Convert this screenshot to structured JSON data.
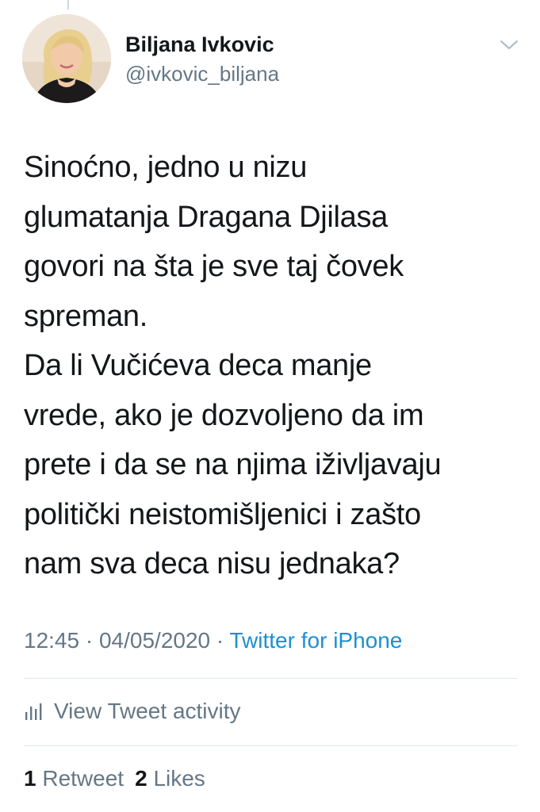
{
  "author": {
    "display_name": "Biljana Ivkovic",
    "handle": "@ivkovic_biljana"
  },
  "tweet": {
    "text": "Sinoćno, jedno u nizu\nglumatanja Dragana Djilasa\ngovori na šta je sve taj čovek\nspreman.\nDa li Vučićeva deca manje\nvrede, ako je dozvoljeno da im\nprete i da se na njima iživljavaju\npolitički neistomišljenici i zašto\nnam sva deca nisu jednaka?"
  },
  "meta": {
    "time": "12:45",
    "separator1": " · ",
    "date": "04/05/2020",
    "separator2": " · ",
    "source": "Twitter for iPhone"
  },
  "activity": {
    "label": "View Tweet activity",
    "icon": "bar-chart-icon"
  },
  "engagement": {
    "retweet_count": "1",
    "retweet_label": "Retweet",
    "like_count": "2",
    "like_label": "Likes"
  },
  "icons": {
    "menu": "chevron-down-icon"
  },
  "colors": {
    "link": "#1d8fd1",
    "secondary_text": "#657786",
    "primary_text": "#14171a",
    "divider": "#e1e8ed"
  }
}
